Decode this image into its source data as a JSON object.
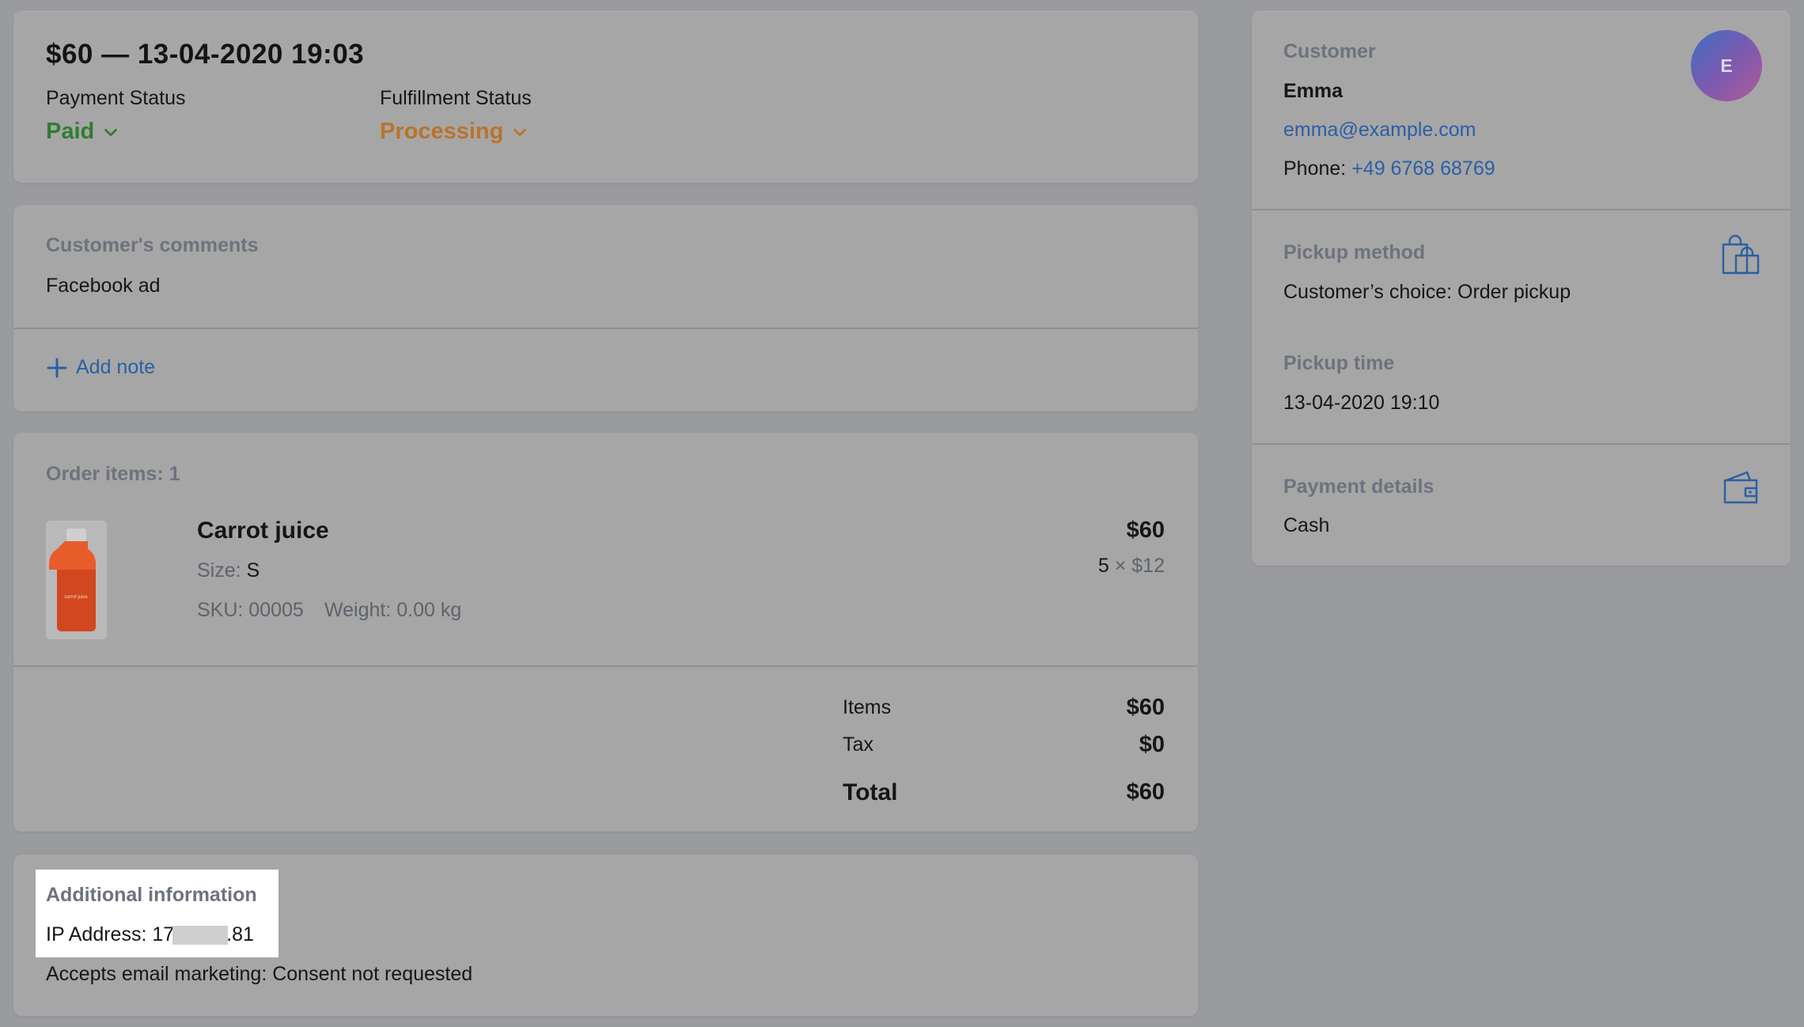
{
  "order": {
    "title": "$60 — 13-04-2020 19:03",
    "payment_status_label": "Payment Status",
    "payment_status_value": "Paid",
    "fulfillment_status_label": "Fulfillment Status",
    "fulfillment_status_value": "Processing"
  },
  "comments": {
    "label": "Customer's comments",
    "text": "Facebook ad",
    "add_note_label": "Add note"
  },
  "items": {
    "count_label": "Order items: 1",
    "list": [
      {
        "name": "Carrot juice",
        "size_label": "Size:",
        "size_value": "S",
        "sku": "SKU: 00005",
        "weight": "Weight: 0.00 kg",
        "price": "$60",
        "quantity": "5",
        "times": "×",
        "unit_price": "$12",
        "bottle_label": "carrot juice"
      }
    ],
    "summary": {
      "items_label": "Items",
      "items_value": "$60",
      "tax_label": "Tax",
      "tax_value": "$0",
      "total_label": "Total",
      "total_value": "$60"
    }
  },
  "additional": {
    "label": "Additional information",
    "ip_prefix": "IP Address: 17",
    "ip_suffix": ".81",
    "marketing": "Accepts email marketing: Consent not requested"
  },
  "customer": {
    "label": "Customer",
    "name": "Emma",
    "avatar_initial": "E",
    "email": "emma@example.com",
    "phone_label": "Phone:",
    "phone": "+49 6768 68769"
  },
  "pickup": {
    "method_label": "Pickup method",
    "method_value": "Customer’s choice: Order pickup",
    "time_label": "Pickup time",
    "time_value": "13-04-2020 19:10"
  },
  "payment": {
    "label": "Payment details",
    "value": "Cash"
  },
  "colors": {
    "paid": "#2f7d32",
    "processing": "#b8742a",
    "link": "#2b5fa5",
    "background": "#999b9f",
    "card": "#a6a6a6"
  },
  "icons": [
    "chevron-down-icon",
    "plus-icon",
    "shopping-bag-icon",
    "wallet-icon"
  ]
}
